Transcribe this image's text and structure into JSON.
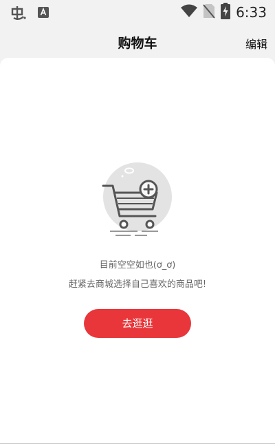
{
  "status_bar": {
    "time": "6:33",
    "icons": [
      "app-notification-icon",
      "keyboard-a-icon",
      "wifi-icon",
      "no-sim-icon",
      "battery-charging-icon"
    ]
  },
  "header": {
    "title": "购物车",
    "edit_label": "编辑"
  },
  "empty_state": {
    "illustration": "empty-cart-icon",
    "line1": "目前空空如也(ơ_ơ)",
    "line2": "赶紧去商城选择自己喜欢的商品吧!",
    "button_label": "去逛逛"
  },
  "colors": {
    "accent": "#e8363a",
    "background": "#f2f2f2",
    "card": "#ffffff"
  }
}
